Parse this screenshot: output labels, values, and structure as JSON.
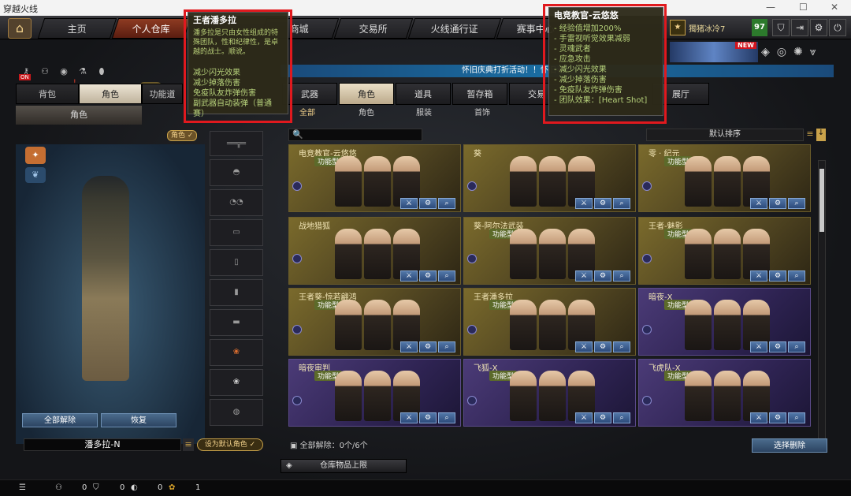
{
  "window": {
    "title": "穿越火线",
    "min": "—",
    "max": "☐",
    "close": "✕"
  },
  "nav": {
    "home_icon": "home-icon",
    "tabs": [
      "主页",
      "个人仓库",
      "商城",
      "交易所",
      "火线通行证",
      "赛事中心"
    ]
  },
  "user": {
    "name": "獨猪冰冷7",
    "level": "97",
    "badge": "NEW",
    "btn_icons": [
      "shield-icon",
      "exit-icon",
      "gear-icon",
      "power-icon"
    ]
  },
  "left": {
    "icons": [
      "key-icon",
      "team-icon",
      "eye-icon",
      "potion-icon",
      "mouse-icon"
    ],
    "on_badge": "ON",
    "warning": "!",
    "tabs": [
      "背包",
      "角色",
      "功能道"
    ],
    "subtab": "角色",
    "char_tag": "角色 ✓",
    "unequip_all": "全部解除",
    "restore": "恢复",
    "char_name": "潘多拉-N",
    "set_default": "设为默认角色 ✓"
  },
  "banner": {
    "text": "怀旧庆典打折活动！！怀旧者"
  },
  "categories": {
    "tabs": [
      "武器",
      "角色",
      "道具",
      "暂存箱",
      "交易",
      "展厅"
    ],
    "subcats": [
      "全部",
      "角色",
      "服装",
      "首饰"
    ],
    "search_icon": "🔍",
    "sort": "默认排序"
  },
  "cards": [
    {
      "name": "电竞教官-云悠悠",
      "tag": "功能型",
      "style": "gold"
    },
    {
      "name": "葵",
      "tag": "",
      "style": "gold"
    },
    {
      "name": "零 · 纪元",
      "tag": "功能型",
      "style": "gold"
    },
    {
      "name": "战地猎狐",
      "tag": "",
      "style": "gold"
    },
    {
      "name": "葵-阿尔法武装",
      "tag": "功能型",
      "style": "gold"
    },
    {
      "name": "王者-魅影",
      "tag": "功能型",
      "style": "gold"
    },
    {
      "name": "王者葵-惊若翩鸿",
      "tag": "功能型",
      "style": "gold"
    },
    {
      "name": "王者潘多拉",
      "tag": "功能型",
      "style": "gold"
    },
    {
      "name": "暗夜-X",
      "tag": "功能型",
      "style": "purple"
    },
    {
      "name": "暗夜审判",
      "tag": "功能型",
      "style": "purple"
    },
    {
      "name": "飞狐-X",
      "tag": "功能型",
      "style": "purple"
    },
    {
      "name": "飞虎队-X",
      "tag": "功能型",
      "style": "purple"
    }
  ],
  "footer": {
    "count_text": "全部解除：0个/6个",
    "select_delete": "选择删除",
    "limit": "仓库物品上限"
  },
  "bottom": {
    "vals": [
      "0",
      "0",
      "0",
      "1"
    ]
  },
  "tooltip1": {
    "title": "王者潘多拉",
    "desc": "潘多拉是只由女性组成的特殊团队，性和纪律性，是卓越的战士。顺说。",
    "effects": [
      "减少闪光效果",
      "减少掉落伤害",
      "免疫队友炸弹伤害",
      "副武器自动装弹（普通赛）"
    ]
  },
  "tooltip2": {
    "title": "电竞教官-云悠悠",
    "effects": [
      "- 经验值增加200%",
      "- 手雷视听觉效果减弱",
      "- 灵魂武者",
      "- 应急攻击",
      "- 减少闪光效果",
      "- 减少掉落伤害",
      "- 免疫队友炸弹伤害",
      "- 团队效果：[Heart Shot]"
    ]
  }
}
